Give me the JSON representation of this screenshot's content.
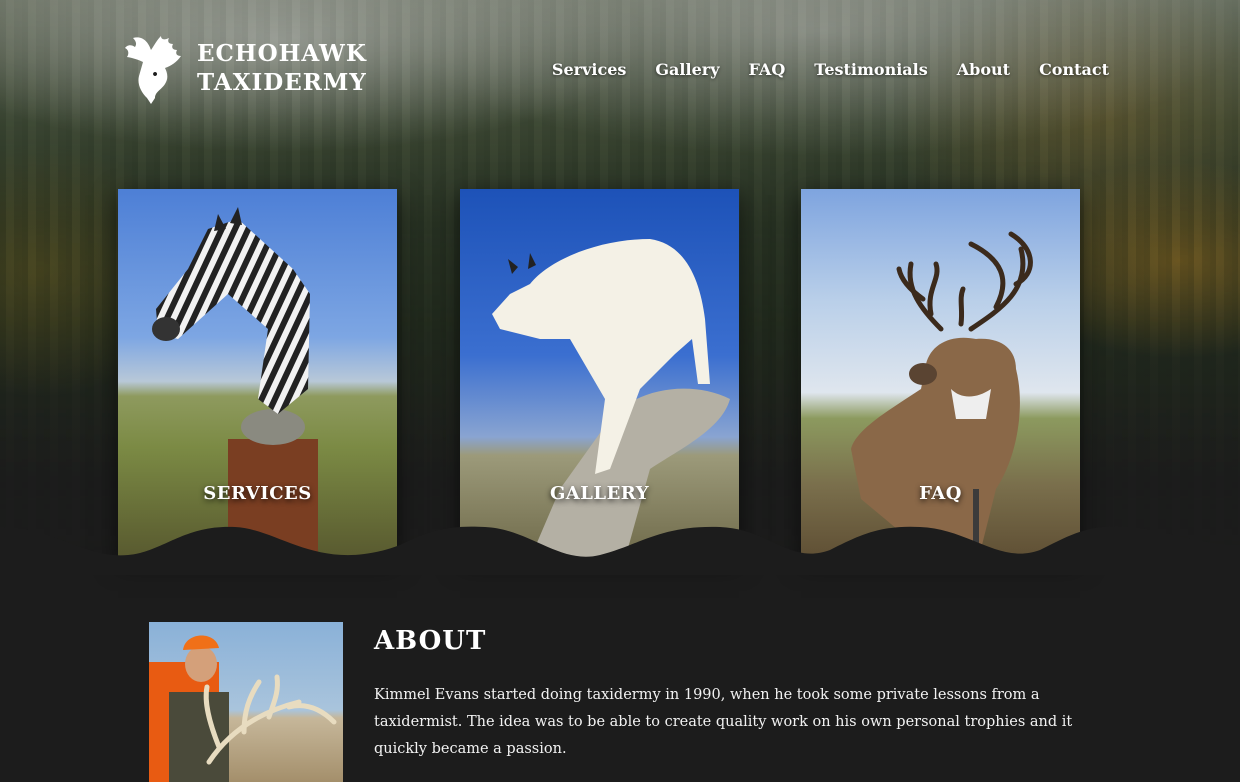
{
  "brand": {
    "line1": "ECHOHAWK",
    "line2": "TAXIDERMY"
  },
  "nav": [
    {
      "label": "Services"
    },
    {
      "label": "Gallery"
    },
    {
      "label": "FAQ"
    },
    {
      "label": "Testimonials"
    },
    {
      "label": "About"
    },
    {
      "label": "Contact"
    }
  ],
  "cards": [
    {
      "label": "SERVICES",
      "image": "zebra-mount"
    },
    {
      "label": "GALLERY",
      "image": "mountain-goat-mount"
    },
    {
      "label": "FAQ",
      "image": "whitetail-deer-mount"
    }
  ],
  "about": {
    "title": "ABOUT",
    "paragraph": "Kimmel Evans started doing taxidermy in 1990, when he took some private lessons from a taxidermist. The idea was to be able to create quality work on his own personal trophies and it quickly became a passion.",
    "photo": "hunter-with-elk-antlers"
  },
  "colors": {
    "background": "#1c1c1c",
    "text": "#ffffff"
  }
}
